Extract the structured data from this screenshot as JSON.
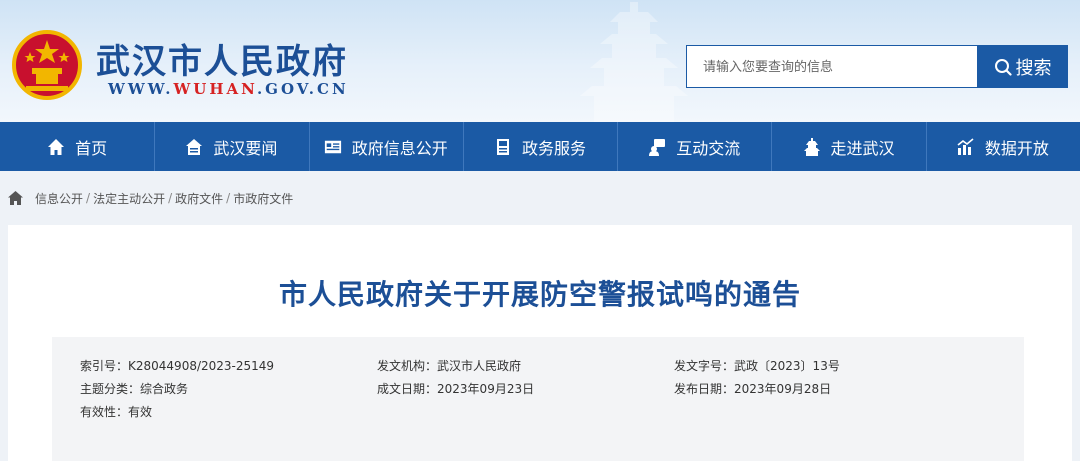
{
  "header": {
    "site_title": "武汉市人民政府",
    "site_url_prefix": "WWW.",
    "site_url_highlight": "WUHAN",
    "site_url_suffix": ".GOV.CN",
    "search": {
      "placeholder": "请输入您要查询的信息",
      "button_label": "搜索"
    }
  },
  "nav": {
    "items": [
      {
        "label": "首页",
        "icon": "home-icon"
      },
      {
        "label": "武汉要闻",
        "icon": "news-icon"
      },
      {
        "label": "政府信息公开",
        "icon": "info-card-icon"
      },
      {
        "label": "政务服务",
        "icon": "service-icon"
      },
      {
        "label": "互动交流",
        "icon": "interact-icon"
      },
      {
        "label": "走进武汉",
        "icon": "tower-icon"
      },
      {
        "label": "数据开放",
        "icon": "data-chart-icon"
      }
    ]
  },
  "breadcrumb": {
    "items": [
      "信息公开",
      "法定主动公开",
      "政府文件",
      "市政府文件"
    ],
    "separator": "/"
  },
  "document": {
    "title": "市人民政府关于开展防空警报试鸣的通告",
    "meta": {
      "index_label": "索引号：",
      "index_value": "K28044908/2023-25149",
      "issuer_label": "发文机构：",
      "issuer_value": "武汉市人民政府",
      "doc_no_label": "发文字号：",
      "doc_no_value": "武政〔2023〕13号",
      "category_label": "主题分类：",
      "category_value": "综合政务",
      "written_date_label": "成文日期：",
      "written_date_value": "2023年09月23日",
      "publish_date_label": "发布日期：",
      "publish_date_value": "2023年09月28日",
      "validity_label": "有效性：",
      "validity_value": "有效"
    }
  },
  "colors": {
    "primary_blue": "#1b5aa5",
    "title_blue": "#1c4f96",
    "url_red": "#d62222"
  }
}
